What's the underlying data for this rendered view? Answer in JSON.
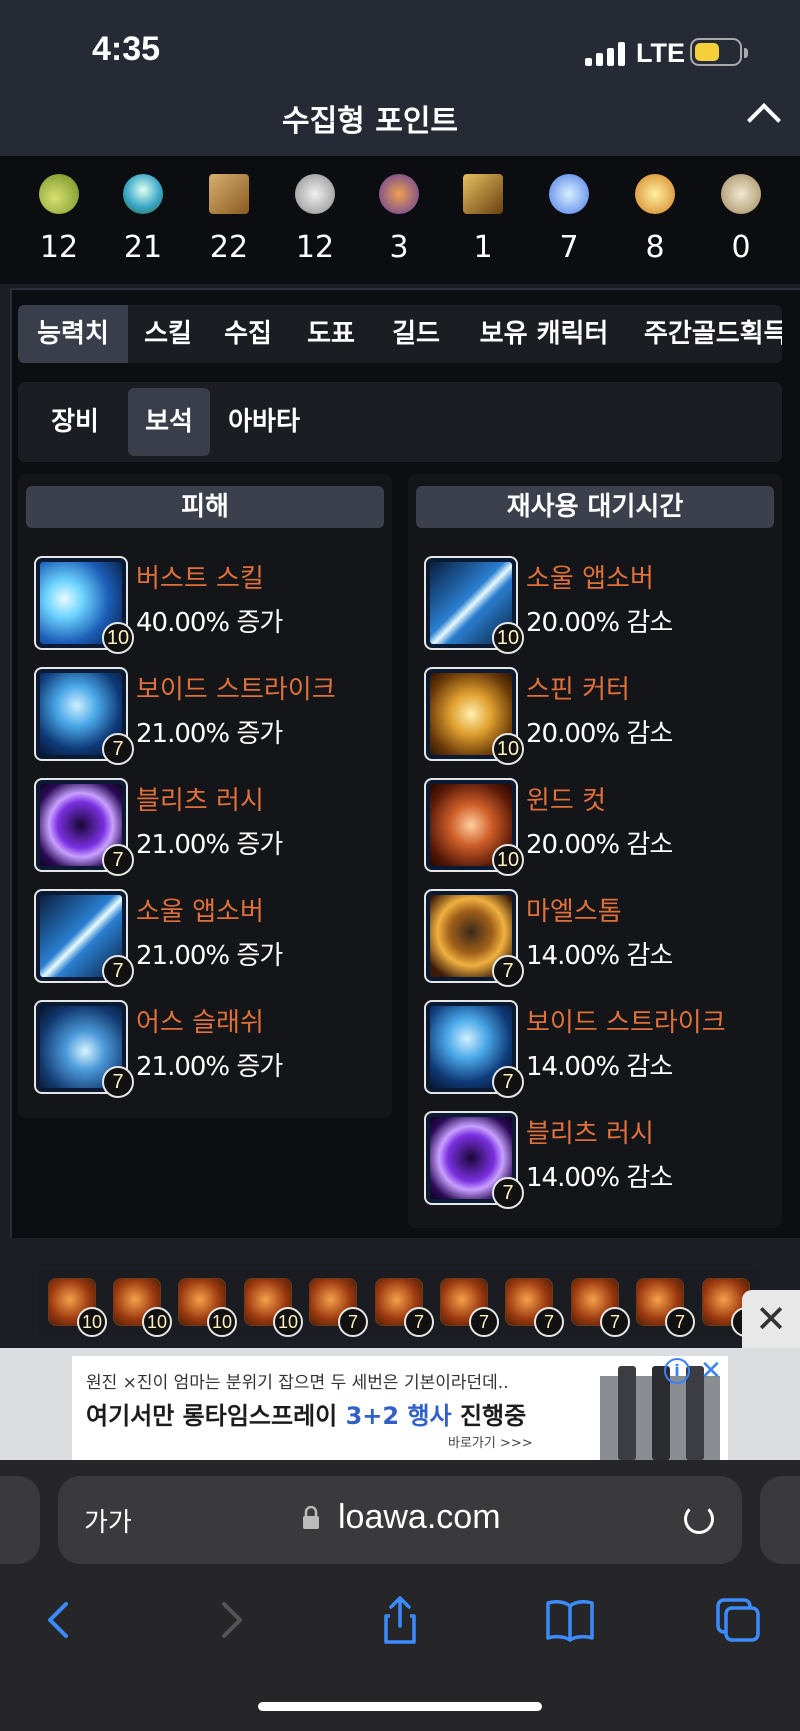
{
  "status": {
    "time": "4:35",
    "network": "LTE"
  },
  "header": {
    "title": "수집형 포인트"
  },
  "collectibles": [
    {
      "icon": "sprout-seed-icon",
      "value": "12"
    },
    {
      "icon": "island-globe-icon",
      "value": "21"
    },
    {
      "icon": "map-scroll-icon",
      "value": "22"
    },
    {
      "icon": "heart-organ-icon",
      "value": "12"
    },
    {
      "icon": "shield-crest-icon",
      "value": "3"
    },
    {
      "icon": "telescope-icon",
      "value": "1"
    },
    {
      "icon": "blue-star-flower-icon",
      "value": "7"
    },
    {
      "icon": "compass-star-icon",
      "value": "8"
    },
    {
      "icon": "gold-coin-icon",
      "value": "0"
    }
  ],
  "tabs": [
    "능력치",
    "스킬",
    "수집",
    "도표",
    "길드",
    "보유 캐릭터",
    "주간골드획득"
  ],
  "subtabs": [
    "장비",
    "보석",
    "아바타"
  ],
  "damage": {
    "title": "피해",
    "gems": [
      {
        "name": "버스트 스킬",
        "effect": "40.00% 증가",
        "level": "10",
        "icon": "burst-skill-icon"
      },
      {
        "name": "보이드 스트라이크",
        "effect": "21.00% 증가",
        "level": "7",
        "icon": "void-strike-icon"
      },
      {
        "name": "블리츠 러시",
        "effect": "21.00% 증가",
        "level": "7",
        "icon": "blitz-rush-icon"
      },
      {
        "name": "소울 앱소버",
        "effect": "21.00% 증가",
        "level": "7",
        "icon": "soul-absorber-icon"
      },
      {
        "name": "어스 슬래쉬",
        "effect": "21.00% 증가",
        "level": "7",
        "icon": "earth-slash-icon"
      }
    ]
  },
  "cooldown": {
    "title": "재사용 대기시간",
    "gems": [
      {
        "name": "소울 앱소버",
        "effect": "20.00% 감소",
        "level": "10",
        "icon": "soul-absorber-icon"
      },
      {
        "name": "스핀 커터",
        "effect": "20.00% 감소",
        "level": "10",
        "icon": "spin-cutter-icon"
      },
      {
        "name": "윈드 컷",
        "effect": "20.00% 감소",
        "level": "10",
        "icon": "wind-cut-icon"
      },
      {
        "name": "마엘스톰",
        "effect": "14.00% 감소",
        "level": "7",
        "icon": "maelstrom-icon"
      },
      {
        "name": "보이드 스트라이크",
        "effect": "14.00% 감소",
        "level": "7",
        "icon": "void-strike-icon"
      },
      {
        "name": "블리츠 러시",
        "effect": "14.00% 감소",
        "level": "7",
        "icon": "blitz-rush-icon"
      }
    ]
  },
  "gem_strip": [
    "10",
    "10",
    "10",
    "10",
    "7",
    "7",
    "7",
    "7",
    "7",
    "7",
    "7"
  ],
  "ad": {
    "subline": "원진 ×진이 엄마는 분위기 잡으면 두 세번은 기본이라던데..",
    "main_prefix": "여기서만 롱타임스프레이 ",
    "main_highlight": "3+2 행사",
    "main_suffix": " 진행중",
    "link": "바로가기 >>>"
  },
  "browser": {
    "aa": "가가",
    "url": "loawa.com"
  }
}
